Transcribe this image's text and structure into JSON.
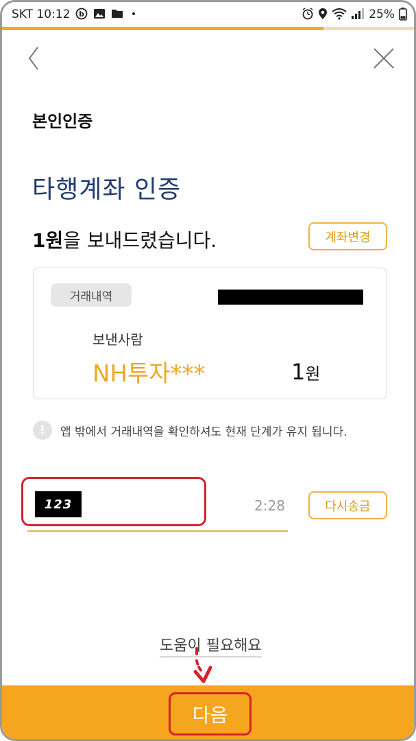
{
  "status_bar": {
    "carrier_time": "SKT 10:12",
    "battery": "25%",
    "left_icons": [
      "b-app-icon",
      "image-icon",
      "folder-icon",
      "dot-icon"
    ],
    "right_icons": [
      "alarm-icon",
      "location-icon",
      "wifi-icon",
      "signal-icon"
    ]
  },
  "progress": {
    "fraction": 0.78,
    "color": "#f6a81e"
  },
  "nav": {
    "back_icon": "chevron-left-icon",
    "close_icon": "close-icon"
  },
  "page": {
    "heading": "본인인증",
    "title": "타행계좌 인증",
    "sent_amount": "1원",
    "sent_rest": "을 보내드렸습니다.",
    "change_account_label": "계좌변경"
  },
  "card": {
    "badge": "거래내역",
    "sender_label": "보낸사람",
    "sender_name": "NH투자***",
    "amount_number": "1",
    "amount_unit": "원"
  },
  "notice": {
    "icon": "exclamation-icon",
    "text": "앱 밖에서 거래내역을 확인하셔도 현재 단계가 유지 됩니다."
  },
  "verify": {
    "code_value": "123",
    "timer": "2:28",
    "resend_label": "다시송금"
  },
  "help": {
    "label": "도움이 필요해요"
  },
  "footer": {
    "next_label": "다음"
  },
  "colors": {
    "accent": "#f5a61e",
    "title_navy": "#1f3b70",
    "highlight_red": "#d6222a"
  }
}
